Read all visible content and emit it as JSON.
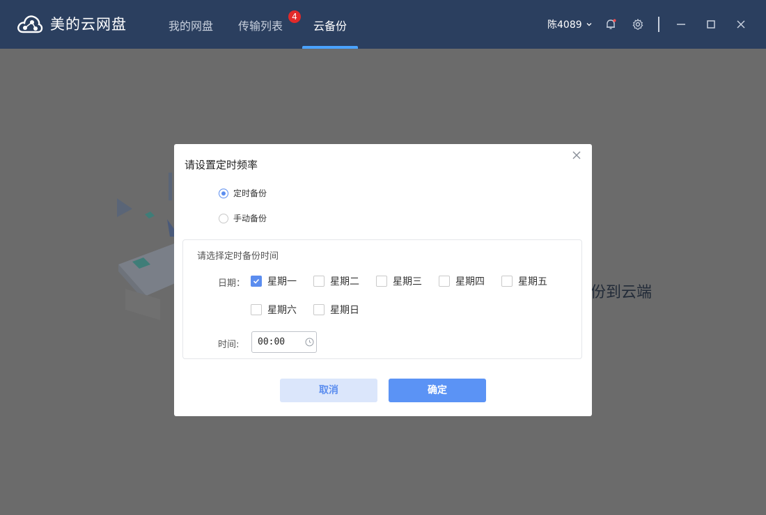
{
  "app": {
    "title": "美的云网盘",
    "tabs": [
      {
        "label": "我的网盘"
      },
      {
        "label": "传输列表",
        "badge": "4"
      },
      {
        "label": "云备份"
      }
    ],
    "user": "陈4089",
    "icons": [
      "bell-icon",
      "gear-icon",
      "minimize-icon",
      "maximize-icon",
      "close-icon"
    ]
  },
  "background": {
    "text": "份到云端"
  },
  "dialog": {
    "title": "请设置定时频率",
    "mode_options": [
      {
        "label": "定时备份",
        "selected": true
      },
      {
        "label": "手动备份",
        "selected": false
      }
    ],
    "schedule": {
      "title": "请选择定时备份时间",
      "date_label": "日期：",
      "days": [
        {
          "label": "星期一",
          "checked": true
        },
        {
          "label": "星期二",
          "checked": false
        },
        {
          "label": "星期三",
          "checked": false
        },
        {
          "label": "星期四",
          "checked": false
        },
        {
          "label": "星期五",
          "checked": false
        },
        {
          "label": "星期六",
          "checked": false
        },
        {
          "label": "星期日",
          "checked": false
        }
      ],
      "time_label": "时间:",
      "time_value": "00:00"
    },
    "cancel_label": "取消",
    "confirm_label": "确定"
  },
  "colors": {
    "titlebar": "#2b3f5f",
    "accent": "#5b8def",
    "overlay": "#6b6b6b",
    "badge": "#e22a2a"
  }
}
